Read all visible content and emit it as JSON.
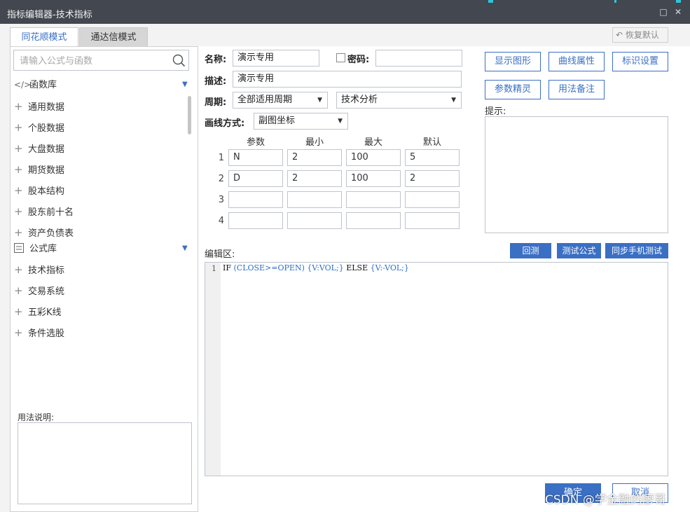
{
  "window": {
    "title": "指标编辑器-技术指标",
    "maximize_icon": "□",
    "close_icon": "✕"
  },
  "tabs": [
    {
      "label": "同花顺模式",
      "active": true
    },
    {
      "label": "通达信模式",
      "active": false
    }
  ],
  "restore_default": "恢复默认",
  "search": {
    "placeholder": "请输入公式与函数"
  },
  "tree": {
    "function_lib": "函数库",
    "function_items": [
      "通用数据",
      "个股数据",
      "大盘数据",
      "期货数据",
      "股本结构",
      "股东前十名",
      "资产负债表"
    ],
    "formula_lib": "公式库",
    "formula_items": [
      "技术指标",
      "交易系统",
      "五彩K线",
      "条件选股"
    ]
  },
  "usage_label": "用法说明:",
  "form": {
    "name_label": "名称:",
    "name_value": "演示专用",
    "password_label": "密码:",
    "desc_label": "描述:",
    "desc_value": "演示专用",
    "period_label": "周期:",
    "period_value": "全部适用周期",
    "category_value": "技术分析",
    "draw_label": "画线方式:",
    "draw_value": "副图坐标"
  },
  "params": {
    "headers": [
      "参数",
      "最小",
      "最大",
      "默认"
    ],
    "rows": [
      {
        "num": "1",
        "name": "N",
        "min": "2",
        "max": "100",
        "default": "5"
      },
      {
        "num": "2",
        "name": "D",
        "min": "2",
        "max": "100",
        "default": "2"
      },
      {
        "num": "3",
        "name": "",
        "min": "",
        "max": "",
        "default": ""
      },
      {
        "num": "4",
        "name": "",
        "min": "",
        "max": "",
        "default": ""
      }
    ]
  },
  "buttons": {
    "show_graph": "显示图形",
    "curve_props": "曲线属性",
    "mark_settings": "标识设置",
    "param_wizard": "参数精灵",
    "usage_notes": "用法备注"
  },
  "hint_label": "提示:",
  "editor": {
    "label": "编辑区:",
    "backtest": "回测",
    "test_formula": "测试公式",
    "sync_mobile": "同步手机测试",
    "line_no": "1",
    "code": {
      "p1": "IF ",
      "p2": "(CLOSE>=OPEN) {V:VOL;} ",
      "p3": "ELSE ",
      "p4": "{V:-VOL;}"
    }
  },
  "footer": {
    "ok": "确定",
    "cancel": "取消"
  },
  "watermark": "CSDN @学金融的廖哥"
}
